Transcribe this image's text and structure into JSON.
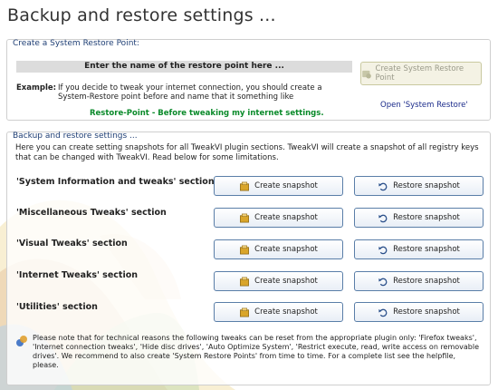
{
  "window": {
    "title": "Backup and restore settings ..."
  },
  "restore_point": {
    "group_label": "Create a System Restore Point:",
    "name_prompt": "Enter the name of the restore point here ...",
    "example_label": "Example:",
    "example_text": "If you decide to tweak your internet connection, you should create a System-Restore point before and name that it something like",
    "example_name": "Restore-Point - Before tweaking my internet settings.",
    "create_button": "Create System Restore Point",
    "open_link": "Open 'System Restore'"
  },
  "backup": {
    "group_label": "Backup and restore settings ...",
    "intro": "Here you can create setting snapshots for all TweakVI plugin sections. TweakVI will create a snapshot of all registry keys that can be changed with TweakVI. Read below for some limitations.",
    "create_label": "Create snapshot",
    "restore_label": "Restore snapshot",
    "sections": [
      {
        "label": "'System Information and tweaks' section"
      },
      {
        "label": "'Miscellaneous Tweaks' section"
      },
      {
        "label": "'Visual Tweaks' section"
      },
      {
        "label": "'Internet Tweaks' section"
      },
      {
        "label": "'Utilities' section"
      }
    ],
    "note": "Please note that for technical reasons the following tweaks can be reset from the appropriate plugin only: 'Firefox tweaks', 'Internet connection tweaks', 'Hide disc drives', 'Auto Optimize System', 'Restrict execute, read, write access on removable drives'. We recommend to also create 'System Restore Points' from time to time. For a complete list see the helpfile, please."
  },
  "colors": {
    "accent": "#1f3f75",
    "green_text": "#0a8a2a",
    "link": "#1a2a8a",
    "button_border": "#5a7ea8"
  }
}
